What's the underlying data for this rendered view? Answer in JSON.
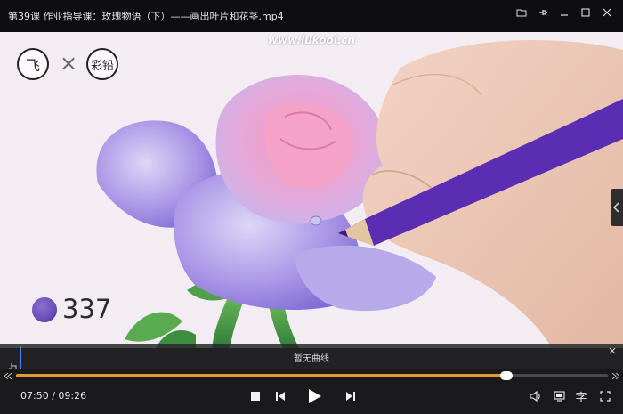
{
  "window": {
    "title": "第39课 作业指导课：玫瑰物语（下）——画出叶片和花茎.mp4"
  },
  "video": {
    "watermark": "www.lukool.cn",
    "logo_left_text": "飞",
    "logo_separator": "×",
    "logo_right_text": "彩铅",
    "color_code": "337",
    "swatch_color": "#6a4db5"
  },
  "curve_panel": {
    "label": "暂无曲线"
  },
  "player": {
    "current_time": "07:50",
    "separator": " / ",
    "total_time": "09:26",
    "progress": 0.828,
    "subtitle_label": "字",
    "accent_color": "#e09a3a"
  }
}
